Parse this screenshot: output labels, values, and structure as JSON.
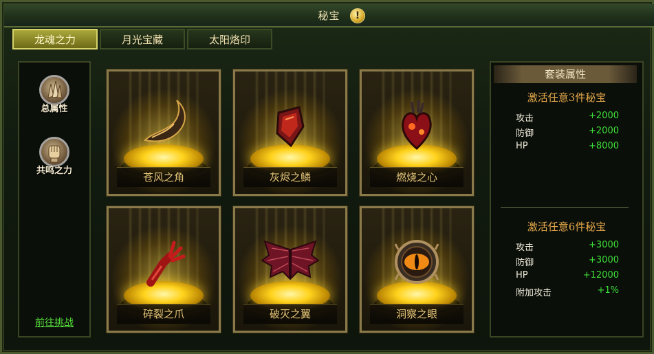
{
  "window": {
    "title": "秘宝",
    "help_icon": "exclamation-icon"
  },
  "tabs": [
    {
      "label": "龙魂之力",
      "active": true
    },
    {
      "label": "月光宝藏",
      "active": false
    },
    {
      "label": "太阳烙印",
      "active": false
    }
  ],
  "sidebar": {
    "buttons": [
      {
        "label": "总属性",
        "icon": "crystal-icon"
      },
      {
        "label": "共鸣之力",
        "icon": "fist-icon"
      }
    ],
    "challenge_link": "前往挑战"
  },
  "treasures": [
    {
      "name": "苍风之角",
      "icon": "horn-icon"
    },
    {
      "name": "灰烬之鳞",
      "icon": "scale-icon"
    },
    {
      "name": "燃烧之心",
      "icon": "heart-icon"
    },
    {
      "name": "碎裂之爪",
      "icon": "claw-icon"
    },
    {
      "name": "破灭之翼",
      "icon": "wings-icon"
    },
    {
      "name": "洞察之眼",
      "icon": "eye-icon"
    }
  ],
  "set_bonus": {
    "title": "套装属性",
    "tiers": [
      {
        "heading": "激活任意3件秘宝",
        "stats": [
          {
            "name": "攻击",
            "value": "+2000"
          },
          {
            "name": "防御",
            "value": "+2000"
          },
          {
            "name": "HP",
            "value": "+8000"
          }
        ]
      },
      {
        "heading": "激活任意6件秘宝",
        "stats": [
          {
            "name": "攻击",
            "value": "+3000"
          },
          {
            "name": "防御",
            "value": "+3000"
          },
          {
            "name": "HP",
            "value": "+12000"
          },
          {
            "name": "附加攻击",
            "value": "+1%"
          }
        ]
      }
    ]
  },
  "colors": {
    "stat_value": "#3ee03a",
    "heading": "#e7a94a",
    "item_name": "#e8c778",
    "link": "#56e03c"
  }
}
